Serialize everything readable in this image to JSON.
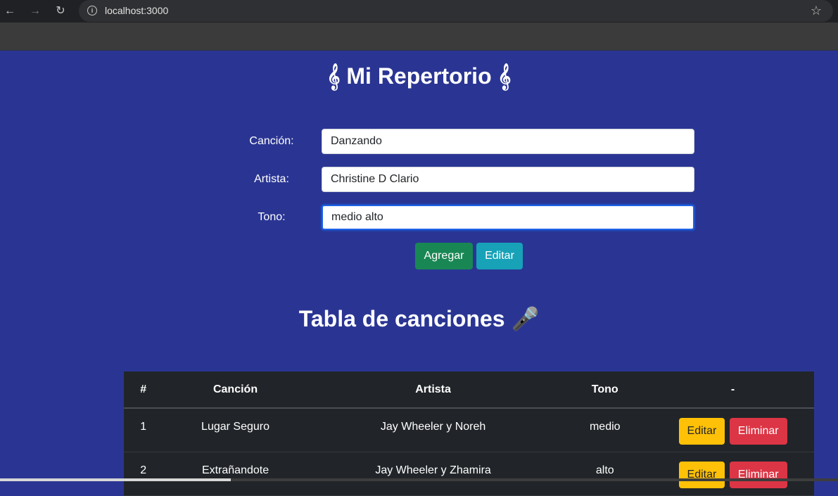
{
  "browser": {
    "url": "localhost:3000"
  },
  "app": {
    "title": "𝄞 Mi Repertorio 𝄞"
  },
  "form": {
    "song_label": "Canción:",
    "song_value": "Danzando",
    "artist_label": "Artista:",
    "artist_value": "Christine D Clario",
    "tone_label": "Tono:",
    "tone_value": "medio alto",
    "add_label": "Agregar",
    "edit_label": "Editar"
  },
  "table": {
    "title": "Tabla de canciones 🎤",
    "headers": [
      "#",
      "Canción",
      "Artista",
      "Tono",
      "-"
    ],
    "rows": [
      {
        "num": "1",
        "song": "Lugar Seguro",
        "artist": "Jay Wheeler y Noreh",
        "tone": "medio",
        "edit": "Editar",
        "delete": "Eliminar"
      },
      {
        "num": "2",
        "song": "Extrañandote",
        "artist": "Jay Wheeler y Zhamira",
        "tone": "alto",
        "edit": "Editar",
        "delete": "Eliminar"
      }
    ]
  },
  "colors": {
    "page_bg": "#2a3593",
    "table_bg": "#212529",
    "add_button": "#198754",
    "edit_button": "#17a2b8",
    "row_edit_button": "#ffc107",
    "row_delete_button": "#dc3545"
  }
}
